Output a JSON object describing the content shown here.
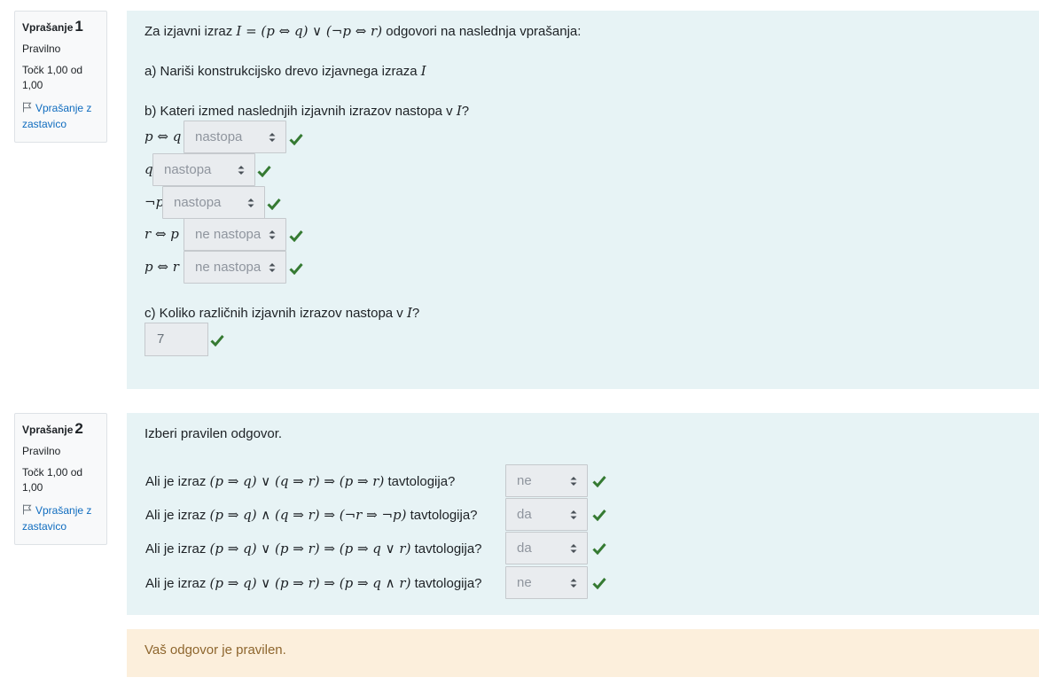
{
  "q1": {
    "info": {
      "label": "Vprašanje",
      "number": "1",
      "status": "Pravilno",
      "points": "Točk 1,00 od 1,00",
      "flag_label": "Vprašanje z zastavico"
    },
    "intro_pre": "Za izjavni izraz",
    "intro_expr": "I = (p ⇔ q) ∨ (¬p ⇔ r)",
    "intro_post": "odgovori na naslednja vprašanja:",
    "part_a_text": "a) Nariši konstrukcijsko drevo izjavnega izraza",
    "part_a_var": "I",
    "part_b_text": "b) Kateri izmed naslednjih izjavnih izrazov nastopa v",
    "part_b_var": "I",
    "part_b_end": "?",
    "rows": [
      {
        "expr": "p ⇔ q",
        "selected": "nastopa"
      },
      {
        "expr": "q",
        "selected": "nastopa"
      },
      {
        "expr": "¬p",
        "selected": "nastopa"
      },
      {
        "expr": "r ⇔ p",
        "selected": "ne nastopa"
      },
      {
        "expr": "p ⇔ r",
        "selected": "ne nastopa"
      }
    ],
    "part_c_text": "c) Koliko različnih izjavnih izrazov nastopa v",
    "part_c_var": "I",
    "part_c_end": "?",
    "part_c_answer": "7"
  },
  "q2": {
    "info": {
      "label": "Vprašanje",
      "number": "2",
      "status": "Pravilno",
      "points": "Točk 1,00 od 1,00",
      "flag_label": "Vprašanje z zastavico"
    },
    "prompt": "Izberi pravilen odgovor.",
    "rows": [
      {
        "pre": "Ali je izraz",
        "expr": "(p ⇒ q) ∨ (q ⇒ r) ⇒ (p ⇒ r)",
        "post": "tavtologija?",
        "selected": "ne"
      },
      {
        "pre": "Ali je izraz",
        "expr": "(p ⇒ q) ∧ (q ⇒ r) ⇒ (¬r ⇒ ¬p)",
        "post": "tavtologija?",
        "selected": "da"
      },
      {
        "pre": "Ali je izraz",
        "expr": "(p ⇒ q) ∨ (p ⇒ r) ⇒ (p ⇒ q ∨ r)",
        "post": "tavtologija?",
        "selected": "da"
      },
      {
        "pre": "Ali je izraz",
        "expr": "(p ⇒ q) ∨ (p ⇒ r) ⇒ (p ⇒ q ∧ r)",
        "post": "tavtologija?",
        "selected": "ne"
      }
    ],
    "feedback": "Vaš odgovor je pravilen."
  },
  "colors": {
    "question_bg": "#e7f3f5",
    "feedback_bg": "#fcefdc",
    "check": "#357a32",
    "link": "#0f6cbf"
  }
}
